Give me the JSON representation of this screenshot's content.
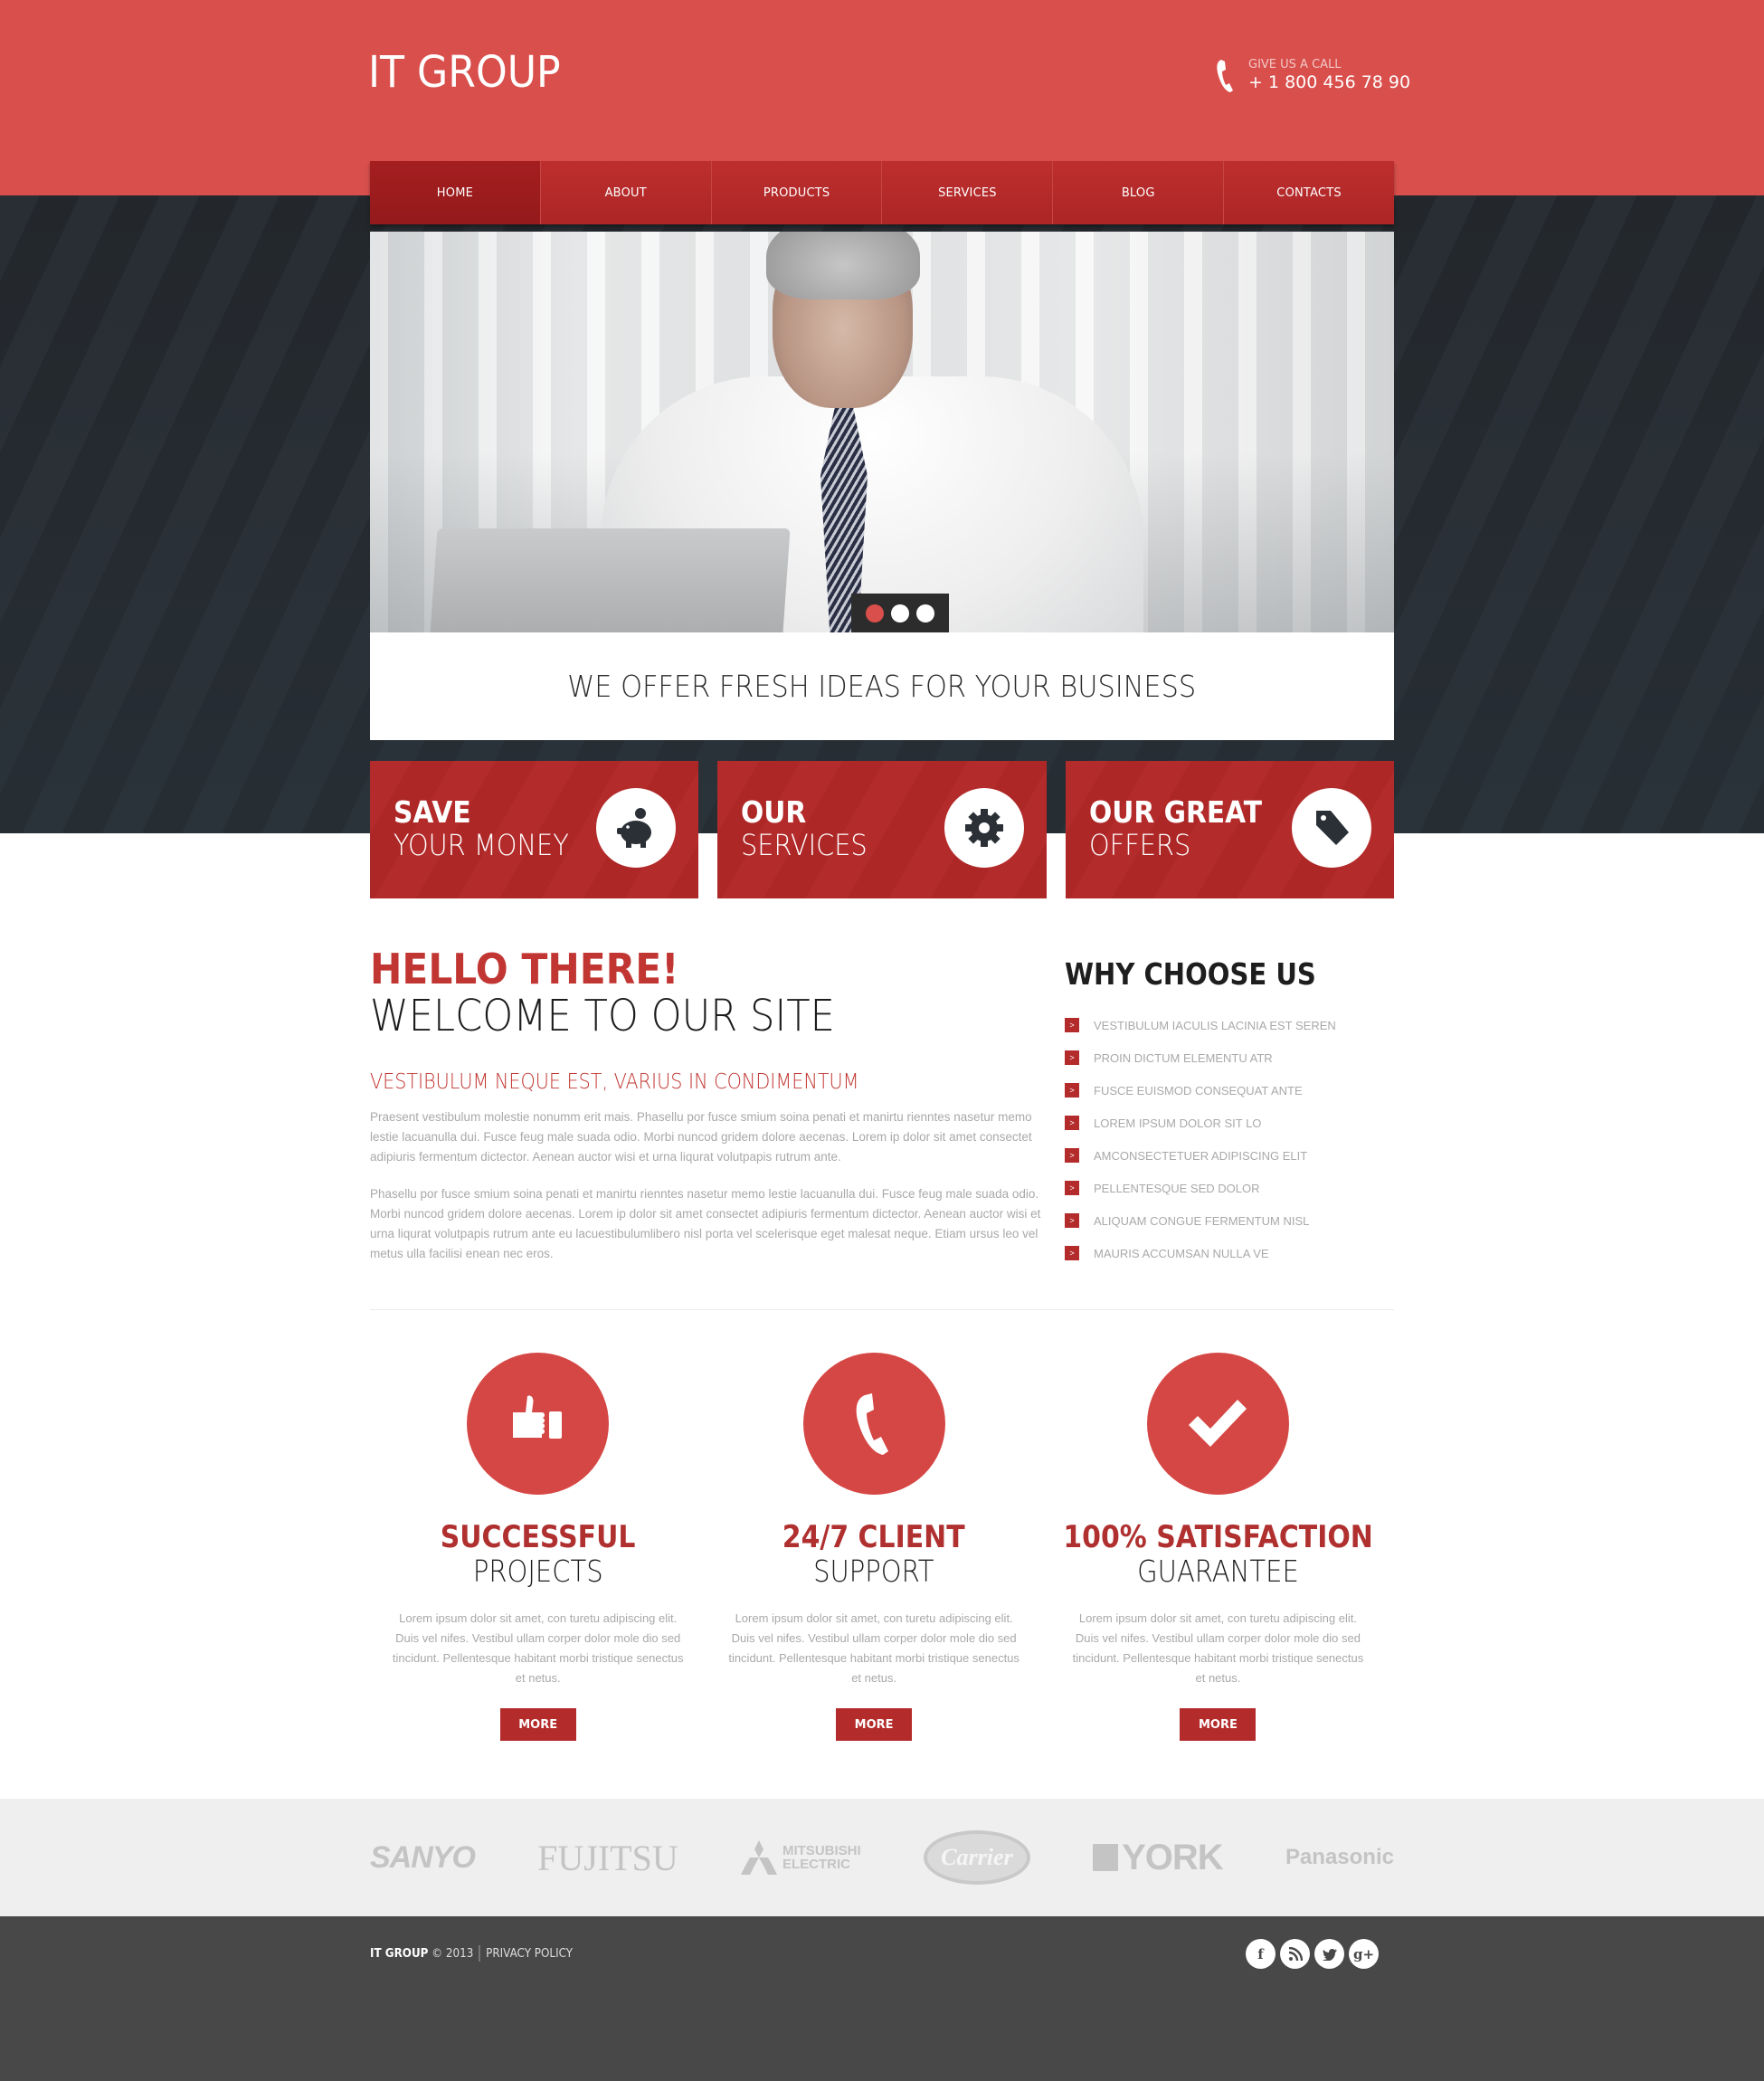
{
  "header": {
    "logo": "IT GROUP",
    "call_label": "GIVE US A CALL",
    "phone": "+ 1 800 456 78 90",
    "phone_icon": "phone-icon"
  },
  "nav": {
    "items": [
      {
        "label": "HOME",
        "active": true
      },
      {
        "label": "ABOUT",
        "active": false
      },
      {
        "label": "PRODUCTS",
        "active": false
      },
      {
        "label": "SERVICES",
        "active": false
      },
      {
        "label": "BLOG",
        "active": false
      },
      {
        "label": "CONTACTS",
        "active": false
      }
    ]
  },
  "slider": {
    "slide_count": 3,
    "active_slide": 1,
    "tagline": "WE OFFER FRESH IDEAS FOR YOUR BUSINESS"
  },
  "features": [
    {
      "line1": "SAVE",
      "line2": "YOUR MONEY",
      "icon": "piggy-bank-icon"
    },
    {
      "line1": "OUR",
      "line2": "SERVICES",
      "icon": "gear-icon"
    },
    {
      "line1": "OUR GREAT",
      "line2": "OFFERS",
      "icon": "tag-icon"
    }
  ],
  "welcome": {
    "title_accent": "HELLO THERE!",
    "title": "WELCOME TO OUR SITE",
    "subtitle": "VESTIBULUM NEQUE EST, VARIUS IN CONDIMENTUM",
    "paragraphs": [
      "Praesent vestibulum molestie nonumm erit mais. Phasellu por fusce smium soina penati et manirtu rienntes nasetur memo lestie lacuanulla dui. Fusce feug male suada odio. Morbi nuncod gridem dolore aecenas. Lorem ip dolor sit amet consectet adipiuris fermentum dictector. Aenean auctor wisi et urna liqurat volutpapis rutrum ante.",
      "Phasellu por fusce smium soina penati et manirtu rienntes nasetur memo lestie lacuanulla dui. Fusce feug male suada odio. Morbi nuncod gridem dolore aecenas. Lorem ip dolor sit amet consectet adipiuris fermentum dictector. Aenean auctor wisi et urna liqurat volutpapis rutrum ante eu lacuestibulumlibero nisl porta vel scelerisque eget malesat neque. Etiam ursus leo vel metus ulla facilisi enean nec eros."
    ]
  },
  "why_choose": {
    "title": "WHY CHOOSE US",
    "bullet_glyph": ">",
    "items": [
      "VESTIBULUM IACULIS LACINIA EST SEREN",
      "PROIN DICTUM ELEMENTU ATR",
      "FUSCE EUISMOD CONSEQUAT ANTE",
      "LOREM IPSUM DOLOR SIT LO",
      "AMCONSECTETUER ADIPISCING ELIT",
      "PELLENTESQUE SED DOLOR",
      "ALIQUAM CONGUE FERMENTUM NISL",
      "MAURIS ACCUMSAN NULLA VE"
    ]
  },
  "services": [
    {
      "title_accent": "SUCCESSFUL",
      "title": "PROJECTS",
      "icon": "thumbs-up-icon",
      "text": "Lorem ipsum dolor sit amet, con turetu adipiscing elit. Duis vel nifes. Vestibul ullam corper dolor mole dio sed tincidunt. Pellentesque habitant morbi tristique senectus et netus.",
      "button": "MORE"
    },
    {
      "title_accent": "24/7 CLIENT",
      "title": "SUPPORT",
      "icon": "phone-icon",
      "text": "Lorem ipsum dolor sit amet, con turetu adipiscing elit. Duis vel nifes. Vestibul ullam corper dolor mole dio sed tincidunt. Pellentesque habitant morbi tristique senectus et netus.",
      "button": "MORE"
    },
    {
      "title_accent": "100% SATISFACTION",
      "title": "GUARANTEE",
      "icon": "checkmark-icon",
      "text": "Lorem ipsum dolor sit amet, con turetu adipiscing elit. Duis vel nifes. Vestibul ullam corper dolor mole dio sed tincidunt. Pellentesque habitant morbi tristique senectus et netus.",
      "button": "MORE"
    }
  ],
  "partners": {
    "sanyo": "SANYO",
    "fujitsu": "FUJITSU",
    "mitsubishi_1": "MITSUBISHI",
    "mitsubishi_2": "ELECTRIC",
    "carrier": "Carrier",
    "york": "YORK",
    "panasonic": "Panasonic"
  },
  "footer": {
    "brand": "IT GROUP",
    "copyright": "© 2013",
    "privacy": "PRIVACY POLICY",
    "social": [
      {
        "name": "facebook-icon",
        "glyph": "f"
      },
      {
        "name": "rss-icon",
        "glyph": ""
      },
      {
        "name": "twitter-icon",
        "glyph": ""
      },
      {
        "name": "google-plus-icon",
        "glyph": "g+"
      }
    ]
  },
  "colors": {
    "header_red": "#d94f4c",
    "accent_red": "#b42b2b",
    "dark_band": "#2b3036",
    "footer": "#484848"
  }
}
